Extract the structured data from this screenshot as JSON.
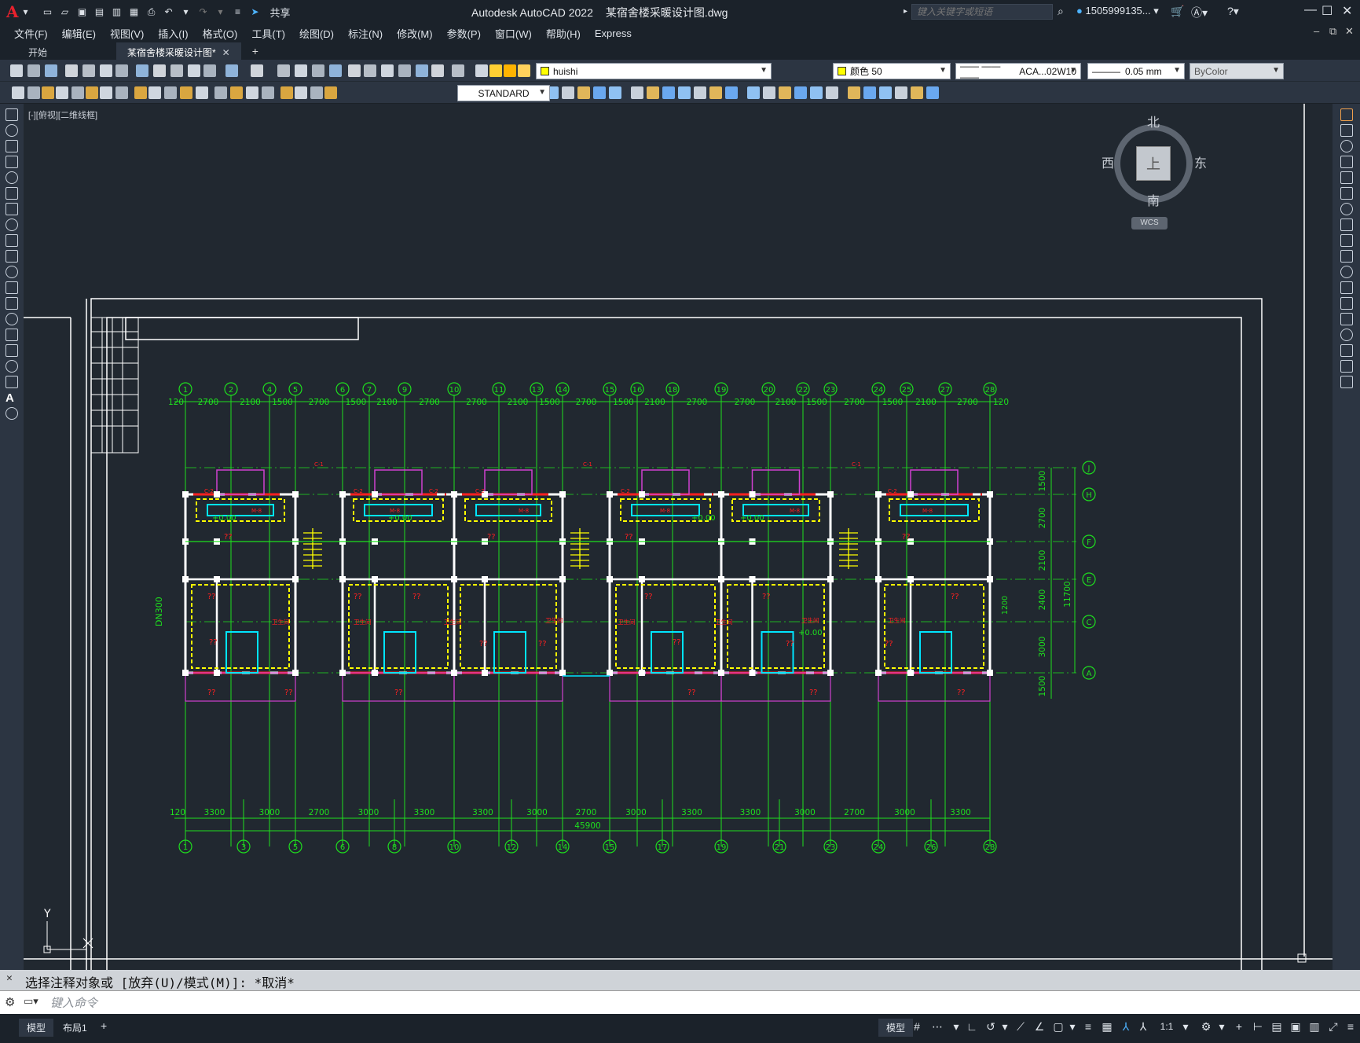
{
  "titlebar": {
    "app_logo": "A",
    "share_label": "共享",
    "app_name": "Autodesk AutoCAD 2022",
    "document": "某宿舍楼采暖设计图.dwg",
    "search_placeholder": "键入关键字或短语",
    "user": "1505999135...",
    "window_controls": [
      "minimize",
      "restore",
      "close"
    ]
  },
  "menu": [
    "文件(F)",
    "编辑(E)",
    "视图(V)",
    "插入(I)",
    "格式(O)",
    "工具(T)",
    "绘图(D)",
    "标注(N)",
    "修改(M)",
    "参数(P)",
    "窗口(W)",
    "帮助(H)",
    "Express"
  ],
  "tabs": [
    {
      "label": "开始",
      "active": false
    },
    {
      "label": "某宿舍楼采暖设计图*",
      "active": true
    }
  ],
  "properties": {
    "layer": "huishi",
    "layer_color": "#ffff00",
    "color_label": "颜色 50",
    "color_swatch": "#ffff00",
    "linetype": "ACA...02W10",
    "lineweight": "0.05 mm",
    "plotstyle": "ByColor",
    "text_style": "STANDARD"
  },
  "canvas": {
    "view_label": "[-][俯视][二维线框]",
    "viewcube": {
      "north": "北",
      "south": "南",
      "east": "东",
      "west": "西",
      "face": "上",
      "wcs": "WCS"
    },
    "ucs": {
      "y": "Y",
      "x": "X"
    }
  },
  "plan": {
    "top_axes": [
      "1",
      "2",
      "4",
      "5",
      "6",
      "7",
      "9",
      "10",
      "11",
      "13",
      "14",
      "15",
      "16",
      "18",
      "19",
      "20",
      "22",
      "23",
      "24",
      "25",
      "27",
      "28"
    ],
    "top_dims": [
      "120",
      "2700",
      "2100",
      "1500",
      "2700",
      "1500",
      "2100",
      "2700",
      "2700",
      "2100",
      "1500",
      "2700",
      "1500",
      "2100",
      "2700",
      "2700",
      "2100",
      "1500",
      "2700",
      "1500",
      "2100",
      "2700",
      "120"
    ],
    "bottom_axes": [
      "1",
      "3",
      "5",
      "6",
      "8",
      "10",
      "12",
      "14",
      "15",
      "17",
      "19",
      "21",
      "23",
      "24",
      "26",
      "28"
    ],
    "bottom_dims": [
      "120",
      "3300",
      "3000",
      "2700",
      "3000",
      "3300",
      "3300",
      "3000",
      "2700",
      "3000",
      "3300",
      "3300",
      "3000",
      "2700",
      "3000",
      "3300"
    ],
    "total_dim": "45900",
    "right_axes": [
      "J",
      "H",
      "F",
      "E",
      "C",
      "A"
    ],
    "right_dims": [
      "1500",
      "2700",
      "2100",
      "2400",
      "3000",
      "1500"
    ],
    "right_total": "11700",
    "right_small": "1200",
    "left_label": "DN300",
    "elevations": [
      "+0.00",
      "+0.00",
      "+0.00",
      "+0.00",
      "+0.00"
    ],
    "unit_labels": [
      "??",
      "??",
      "??",
      "??",
      "??",
      "??",
      "??",
      "??",
      "??",
      "??",
      "??",
      "??",
      "??",
      "??",
      "??",
      "??",
      "??",
      "??",
      "??",
      "??",
      "??",
      "??"
    ],
    "room_labels": [
      "卫生间",
      "卫生间",
      "卫生间",
      "卫生间",
      "卫生间",
      "卫生间",
      "卫生间",
      "卫生间"
    ],
    "window_tags": [
      "C-1",
      "C-1",
      "C-1",
      "C-2",
      "C-2",
      "C-2",
      "C-2",
      "C-2",
      "C-2",
      "M-8",
      "M-8",
      "M-8",
      "M-8",
      "M-8",
      "M-8"
    ]
  },
  "command": {
    "history": "选择注释对象或 [放弃(U)/模式(M)]: *取消*",
    "placeholder": "键入命令"
  },
  "layout_tabs": [
    "模型",
    "布局1"
  ],
  "status": {
    "scale": "1:1"
  },
  "colors": {
    "grid": "#1ee01e",
    "wall": "#ffffff",
    "window": "#ff2020",
    "dashed": "#ffff00",
    "pipe": "#00e5ff",
    "magenta": "#d040d0"
  }
}
